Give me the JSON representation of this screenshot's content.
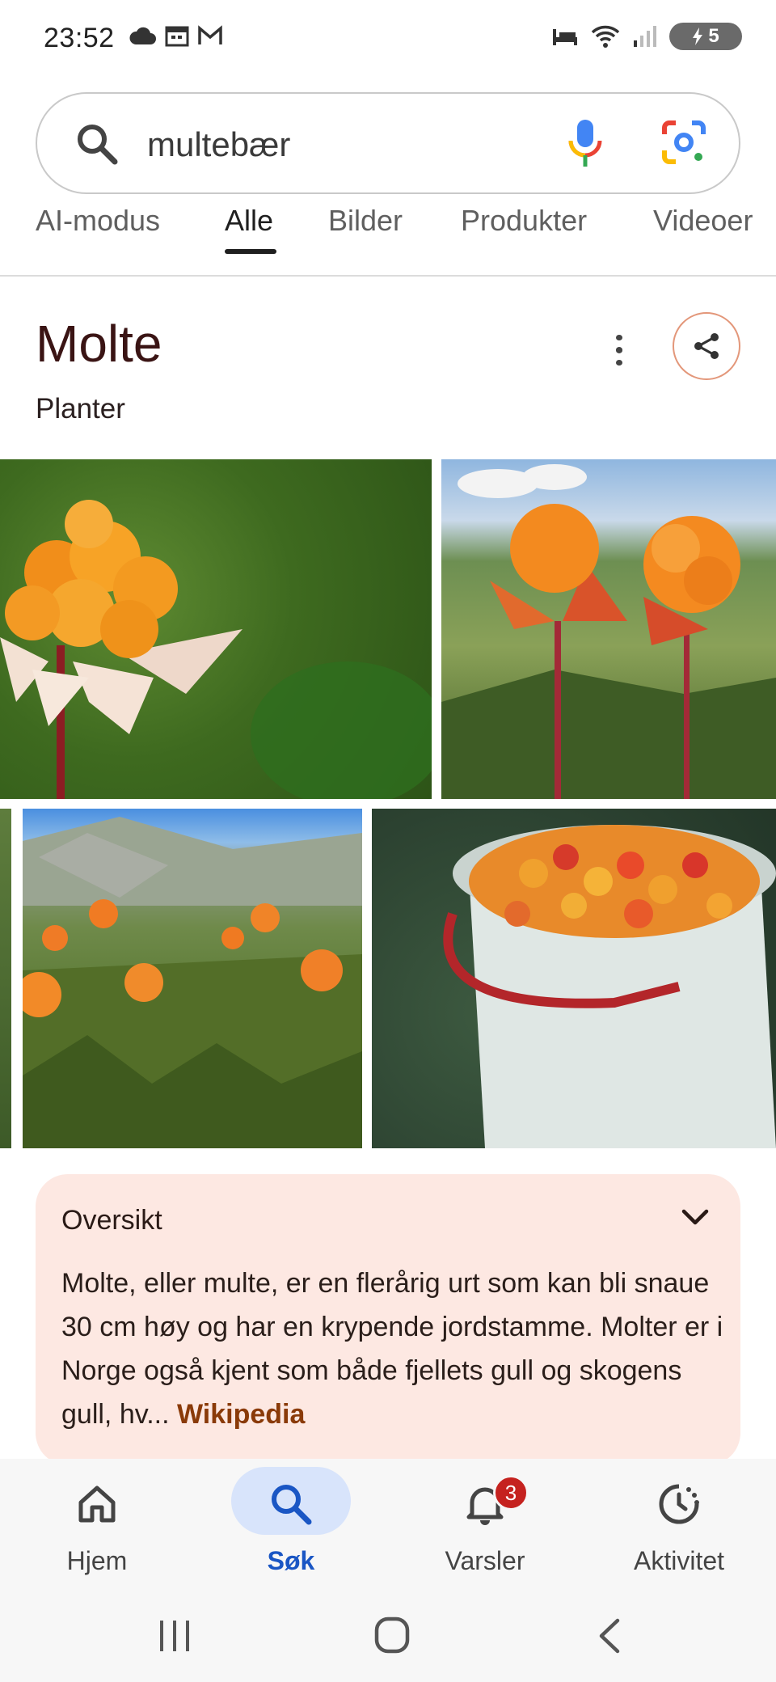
{
  "status_bar": {
    "time": "23:52",
    "battery": "5",
    "left_icons": [
      "cloud-icon",
      "calendar-icon",
      "gmail-icon"
    ],
    "right_icons": [
      "bed-icon",
      "wifi-icon",
      "signal-icon",
      "battery-icon"
    ]
  },
  "search": {
    "query": "multebær",
    "icons": [
      "search-icon",
      "mic-icon",
      "lens-icon"
    ]
  },
  "tabs": [
    {
      "label": "AI-modus",
      "active": false
    },
    {
      "label": "Alle",
      "active": true
    },
    {
      "label": "Bilder",
      "active": false
    },
    {
      "label": "Produkter",
      "active": false
    },
    {
      "label": "Videoer",
      "active": false
    }
  ],
  "knowledge_panel": {
    "title": "Molte",
    "subtitle": "Planter"
  },
  "overview": {
    "title": "Oversikt",
    "text": "Molte, eller multe, er en flerårig urt som kan bli snaue 30 cm høy og har en krypende jordstamme. Molter er i Norge også kjent som både fjellets gull og skogens gull, hv",
    "ellipsis": "... ",
    "source": "Wikipedia"
  },
  "bottom_nav": [
    {
      "label": "Hjem",
      "icon": "home-icon",
      "active": false
    },
    {
      "label": "Søk",
      "icon": "search-icon",
      "active": true
    },
    {
      "label": "Varsler",
      "icon": "bell-icon",
      "active": false,
      "badge": "3"
    },
    {
      "label": "Aktivitet",
      "icon": "activity-icon",
      "active": false
    }
  ],
  "colors": {
    "accent": "#1a56c4",
    "overview_bg": "#fde8e2",
    "title": "#3a1414",
    "source_link": "#8a3a08"
  }
}
